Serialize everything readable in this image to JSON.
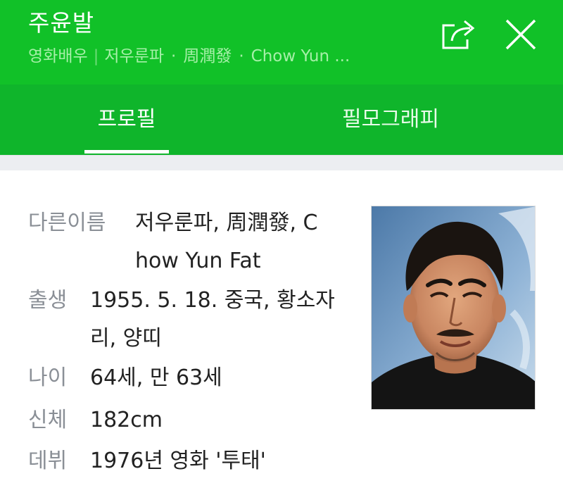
{
  "header": {
    "title": "주윤발",
    "subtitle": {
      "occupation": "영화배우",
      "separator": "|",
      "alias1": "저우룬파",
      "alias2": "周潤發",
      "alias3": "Chow Yun ...",
      "dot": "·"
    },
    "share_icon": "share-icon",
    "close_icon": "close-icon"
  },
  "tabs": [
    {
      "label": "프로필",
      "active": true
    },
    {
      "label": "필모그래피",
      "active": false
    }
  ],
  "profile": {
    "other_names": {
      "label": "다른이름",
      "line1": "저우룬파, 周潤發, C",
      "line2": "how Yun Fat"
    },
    "birth": {
      "label": "출생",
      "line1": "1955. 5. 18. 중국, 황소자",
      "line2": "리, 양띠"
    },
    "age": {
      "label": "나이",
      "value": "64세, 만 63세"
    },
    "body": {
      "label": "신체",
      "value": "182cm"
    },
    "debut": {
      "label": "데뷔",
      "value": "1976년 영화 '투태'"
    }
  },
  "colors": {
    "header_green": "#11c128",
    "tab_green": "#0fb52b",
    "label_gray": "#8a8f96"
  }
}
